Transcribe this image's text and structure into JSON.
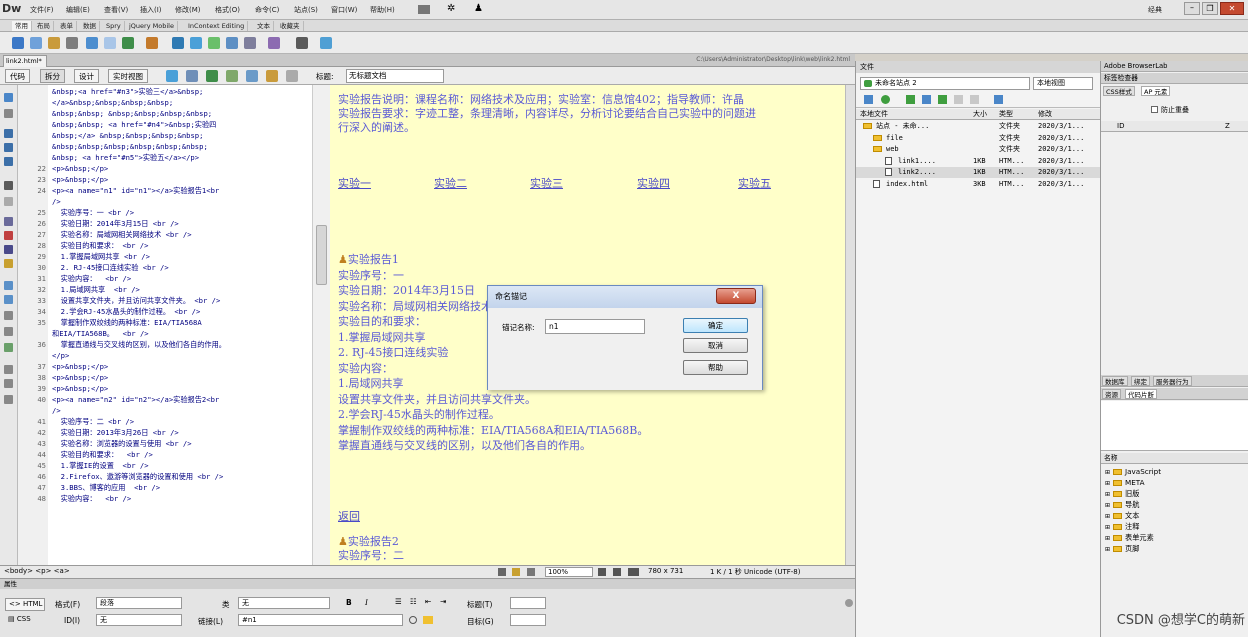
{
  "app": {
    "logo": "Dw",
    "menus": [
      "文件(F)",
      "编辑(E)",
      "查看(V)",
      "插入(I)",
      "修改(M)",
      "格式(O)",
      "命令(C)",
      "站点(S)",
      "窗口(W)",
      "帮助(H)"
    ],
    "workspace": "经典"
  },
  "insert_tabs": [
    "常用",
    "布局",
    "表单",
    "数据",
    "Spry",
    "jQuery Mobile",
    "InContext Editing",
    "文本",
    "收藏夹"
  ],
  "document": {
    "tab": "link2.html*",
    "path": "C:\\Users\\Administrator\\Desktop\\link\\web\\link2.html",
    "title_label": "标题:",
    "title_value": "无标题文档"
  },
  "view_buttons": [
    "代码",
    "拆分",
    "设计",
    "实时视图"
  ],
  "code_lines": [
    {
      "n": "",
      "t": "&nbsp;<a href=\"#n3\">实验三</a>&nbsp;"
    },
    {
      "n": "",
      "t": "</a>&nbsp;&nbsp;&nbsp;&nbsp;"
    },
    {
      "n": "",
      "t": "&nbsp;&nbsp; &nbsp;&nbsp;&nbsp;&nbsp;"
    },
    {
      "n": "",
      "t": "&nbsp;&nbsp; <a href=\"#n4\">&nbsp;实验四"
    },
    {
      "n": "",
      "t": "&nbsp;</a> &nbsp;&nbsp;&nbsp;&nbsp;"
    },
    {
      "n": "",
      "t": "&nbsp;&nbsp;&nbsp;&nbsp;&nbsp;&nbsp;"
    },
    {
      "n": "",
      "t": "&nbsp; <a href=\"#n5\">实验五</a></p>"
    },
    {
      "n": "22",
      "t": "<p>&nbsp;</p>"
    },
    {
      "n": "23",
      "t": "<p>&nbsp;</p>"
    },
    {
      "n": "24",
      "t": "<p><a name=\"n1\" id=\"n1\"></a>实验报告1<br"
    },
    {
      "n": "",
      "t": "/>"
    },
    {
      "n": "25",
      "t": "  实验序号：一 <br />"
    },
    {
      "n": "26",
      "t": "  实验日期：2014年3月15日 <br />"
    },
    {
      "n": "27",
      "t": "  实验名称：局域网相关网络技术 <br />"
    },
    {
      "n": "28",
      "t": "  实验目的和要求： <br />"
    },
    {
      "n": "29",
      "t": "  1.掌握局域网共享 <br />"
    },
    {
      "n": "30",
      "t": "  2. RJ-45接口连线实验 <br />"
    },
    {
      "n": "31",
      "t": "  实验内容：  <br />"
    },
    {
      "n": "32",
      "t": "  1.局域网共享  <br />"
    },
    {
      "n": "33",
      "t": "  设置共享文件夹，并且访问共享文件夹。 <br />"
    },
    {
      "n": "34",
      "t": "  2.学会RJ-45水晶头的制作过程。 <br />"
    },
    {
      "n": "35",
      "t": "  掌握制作双绞线的两种标准：EIA/TIA568A"
    },
    {
      "n": "",
      "t": "和EIA/TIA568B。  <br />"
    },
    {
      "n": "36",
      "t": "  掌握直通线与交叉线的区别，以及他们各自的作用。"
    },
    {
      "n": "",
      "t": "</p>"
    },
    {
      "n": "37",
      "t": "<p>&nbsp;</p>"
    },
    {
      "n": "38",
      "t": "<p>&nbsp;</p>"
    },
    {
      "n": "39",
      "t": "<p>&nbsp;</p>"
    },
    {
      "n": "40",
      "t": "<p><a name=\"n2\" id=\"n2\"></a>实验报告2<br"
    },
    {
      "n": "",
      "t": "/>"
    },
    {
      "n": "41",
      "t": "  实验序号：二 <br />"
    },
    {
      "n": "42",
      "t": "  实验日期：2013年3月26日 <br />"
    },
    {
      "n": "43",
      "t": "  实验名称：浏览器的设置与使用 <br />"
    },
    {
      "n": "44",
      "t": "  实验目的和要求：  <br />"
    },
    {
      "n": "45",
      "t": "  1.掌握IE的设置  <br />"
    },
    {
      "n": "46",
      "t": "  2.Firefox、遨游等浏览器的设置和使用 <br />"
    },
    {
      "n": "47",
      "t": "  3.BBS、博客的应用  <br />"
    },
    {
      "n": "48",
      "t": "  实验内容：  <br />"
    }
  ],
  "design": {
    "intro": [
      "实验报告说明：课程名称：网络技术及应用；实验室：信息馆402；指导教师：许晶",
      "实验报告要求：字迹工整，条理清晰，内容详尽，分析讨论要结合自己实验中的问题进",
      "行深入的阐述。"
    ],
    "links": [
      "实验一",
      "实验二",
      "实验三",
      "实验四",
      "实验五"
    ],
    "report1": [
      "实验报告1",
      "实验序号：一",
      "实验日期：2014年3月15日",
      "实验名称：局域网相关网络技术",
      "实验目的和要求：",
      "1.掌握局域网共享",
      "2. RJ-45接口连线实验",
      "实验内容：",
      "1.局域网共享",
      "设置共享文件夹，并且访问共享文件夹。",
      "2.学会RJ-45水晶头的制作过程。",
      "掌握制作双绞线的两种标准：EIA/TIA568A和EIA/TIA568B。",
      "掌握直通线与交叉线的区别，以及他们各自的作用。"
    ],
    "back": "返回",
    "report2": [
      "实验报告2",
      "实验序号：二"
    ]
  },
  "status": {
    "tags": "<body> <p> <a>",
    "zoom": "100%",
    "size": "780 x 731",
    "info": "1 K / 1 秒 Unicode (UTF-8)"
  },
  "properties": {
    "strip": "属性",
    "html_btn": "HTML",
    "css_btn": "CSS",
    "format_label": "格式(F)",
    "format_value": "段落",
    "class_label": "类",
    "class_value": "无",
    "id_label": "ID(I)",
    "id_value": "无",
    "link_label": "链接(L)",
    "link_value": "#n1",
    "title_label": "标题(T)",
    "target_label": "目标(G)",
    "bold": "B",
    "italic": "I"
  },
  "files": {
    "panel_title": "文件",
    "site": "未命名站点 2",
    "view": "本地视图",
    "headers": [
      "本地文件",
      "大小",
      "类型",
      "修改"
    ],
    "rows": [
      {
        "name": "站点 - 未命...",
        "size": "",
        "type": "文件夹",
        "mod": "2020/3/1..."
      },
      {
        "name": "file",
        "size": "",
        "type": "文件夹",
        "mod": "2020/3/1..."
      },
      {
        "name": "web",
        "size": "",
        "type": "文件夹",
        "mod": "2020/3/1..."
      },
      {
        "name": "link1....",
        "size": "1KB",
        "type": "HTM...",
        "mod": "2020/3/1..."
      },
      {
        "name": "link2....",
        "size": "1KB",
        "type": "HTM...",
        "mod": "2020/3/1..."
      },
      {
        "name": "index.html",
        "size": "3KB",
        "type": "HTM...",
        "mod": "2020/3/1..."
      }
    ]
  },
  "right": {
    "browserlab": "Adobe BrowserLab",
    "inspector": "标签检查器",
    "tab_css": "CSS样式",
    "tab_ap": "AP 元素",
    "prevent_overlap": "防止重叠",
    "col_id": "ID",
    "col_z": "Z",
    "db_tabs": [
      "数据库",
      "绑定",
      "服务器行为"
    ],
    "snip_tabs": [
      "资源",
      "代码片断"
    ],
    "name_header": "名称",
    "snippets": [
      "JavaScript",
      "META",
      "旧版",
      "导航",
      "文本",
      "注释",
      "表单元素",
      "页脚"
    ]
  },
  "dialog": {
    "title": "命名锚记",
    "close": "X",
    "label": "锚记名称:",
    "value": "n1",
    "ok": "确定",
    "cancel": "取消",
    "help": "帮助"
  },
  "watermark": "CSDN @想学C的萌新"
}
